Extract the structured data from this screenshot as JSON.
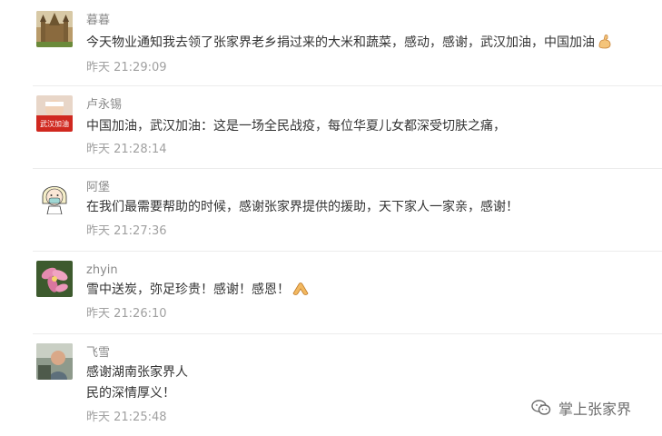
{
  "comments": [
    {
      "name": "暮暮",
      "text": "今天物业通知我去领了张家界老乡捐过来的大米和蔬菜，感动，感谢，武汉加油，中国加油",
      "emoji": "flexed-biceps",
      "time": "昨天 21:29:09"
    },
    {
      "name": "卢永锡",
      "text": "中国加油，武汉加油：这是一场全民战疫，每位华夏儿女都深受切肤之痛，",
      "avatar_text": "武汉加油",
      "time": "昨天 21:28:14"
    },
    {
      "name": "阿堡",
      "text": "在我们最需要帮助的时候，感谢张家界提供的援助，天下家人一家亲，感谢！",
      "time": "昨天 21:27:36"
    },
    {
      "name": "zhyin",
      "text": "雪中送炭，弥足珍贵！感谢！感恩！",
      "emoji": "folded-hands",
      "time": "昨天 21:26:10"
    },
    {
      "name": "飞雪",
      "text_lines": [
        "感谢湖南张家界人",
        "民的深情厚义！"
      ],
      "time": "昨天 21:25:48"
    }
  ],
  "watermark": {
    "icon": "wechat-icon",
    "label": "掌上张家界"
  }
}
